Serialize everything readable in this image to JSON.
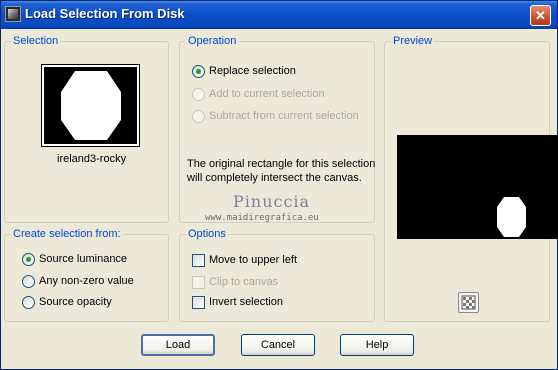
{
  "window": {
    "title": "Load Selection From Disk",
    "close_symbol": "✕"
  },
  "selection": {
    "legend": "Selection",
    "name": "ireland3-rocky"
  },
  "operation": {
    "legend": "Operation",
    "options": [
      {
        "label": "Replace selection",
        "checked": true,
        "disabled": false
      },
      {
        "label": "Add to current selection",
        "checked": false,
        "disabled": true
      },
      {
        "label": "Subtract from current selection",
        "checked": false,
        "disabled": true
      }
    ],
    "info": [
      "The original rectangle for this selection",
      "will completely intersect the canvas."
    ]
  },
  "preview": {
    "legend": "Preview"
  },
  "create_from": {
    "legend": "Create selection from:",
    "options": [
      {
        "label": "Source luminance",
        "checked": true
      },
      {
        "label": "Any non-zero value",
        "checked": false
      },
      {
        "label": "Source opacity",
        "checked": false
      }
    ]
  },
  "options": {
    "legend": "Options",
    "items": [
      {
        "label": "Move to upper left",
        "checked": false,
        "disabled": false
      },
      {
        "label": "Clip to canvas",
        "checked": false,
        "disabled": true
      },
      {
        "label": "Invert selection",
        "checked": false,
        "disabled": false
      }
    ]
  },
  "watermark": {
    "line1": "Pinuccia",
    "line2": "www.maidiregrafica.eu"
  },
  "buttons": {
    "load": "Load",
    "cancel": "Cancel",
    "help": "Help"
  }
}
